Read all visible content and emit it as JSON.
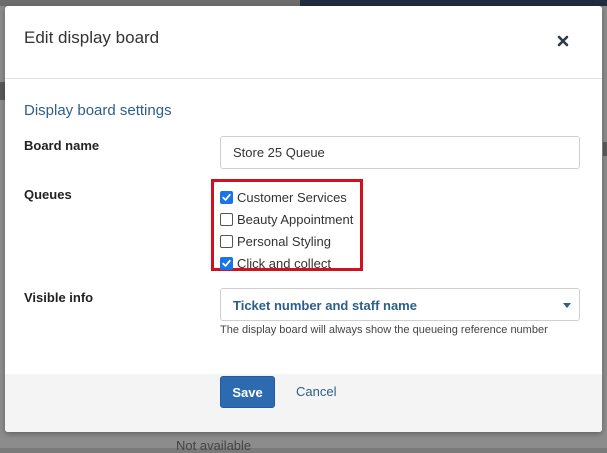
{
  "background": {
    "bottom_text": "Not available"
  },
  "dialog": {
    "title": "Edit display board",
    "close_icon": "close-icon"
  },
  "settings": {
    "section_title": "Display board settings",
    "board_name": {
      "label": "Board name",
      "value": "Store 25 Queue"
    },
    "queues": {
      "label": "Queues",
      "items": [
        {
          "label": "Customer Services",
          "checked": true
        },
        {
          "label": "Beauty Appointment",
          "checked": false
        },
        {
          "label": "Personal Styling",
          "checked": false
        },
        {
          "label": "Click and collect",
          "checked": true
        }
      ],
      "highlight_color": "#d0121f"
    },
    "visible_info": {
      "label": "Visible info",
      "selected": "Ticket number and staff name",
      "helper": "The display board will always show the queueing reference number"
    }
  },
  "footer": {
    "save_label": "Save",
    "cancel_label": "Cancel"
  },
  "colors": {
    "accent": "#2c5f8a",
    "primary_button": "#2d6bb0",
    "checkbox": "#1a73e8"
  }
}
